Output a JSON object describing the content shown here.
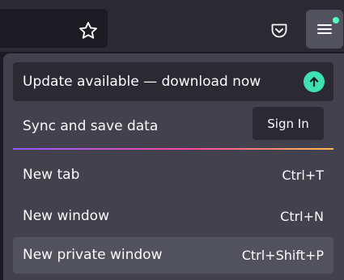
{
  "colors": {
    "toolbar": "#2b2a33",
    "urlbar": "#1c1b22",
    "panel": "#42414d",
    "hover": "#52525e",
    "update_accent": "#3fe1b0",
    "notification_dot": "#54ffbd",
    "text": "#fbfbfe"
  },
  "toolbar": {
    "bookmark_icon": "star-outline",
    "pocket_icon": "pocket",
    "menu_icon": "hamburger-menu",
    "menu_has_notification": true
  },
  "app_menu": {
    "update": {
      "label": "Update available — download now",
      "icon": "arrow-up-circle"
    },
    "sync": {
      "label": "Sync and save data",
      "button_label": "Sign In"
    },
    "items": [
      {
        "label": "New tab",
        "shortcut": "Ctrl+T",
        "hovered": false
      },
      {
        "label": "New window",
        "shortcut": "Ctrl+N",
        "hovered": false
      },
      {
        "label": "New private window",
        "shortcut": "Ctrl+Shift+P",
        "hovered": true
      }
    ]
  }
}
